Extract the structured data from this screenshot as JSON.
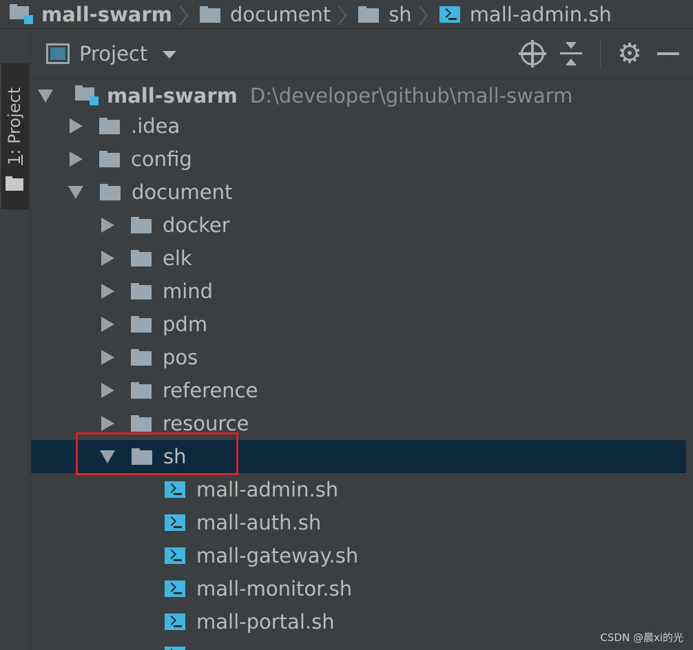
{
  "breadcrumb": {
    "items": [
      {
        "label": "mall-swarm",
        "icon": "module-folder-icon"
      },
      {
        "label": "document",
        "icon": "folder-icon"
      },
      {
        "label": "sh",
        "icon": "folder-icon"
      },
      {
        "label": "mall-admin.sh",
        "icon": "shell-script-icon"
      }
    ]
  },
  "toolwindow_tab": {
    "number": "1",
    "label": ": Project"
  },
  "header": {
    "title": "Project",
    "tools": [
      "locate-icon",
      "collapse-all-icon",
      "gear-icon",
      "hide-icon"
    ],
    "gear_glyph": "⚙"
  },
  "tree": {
    "root": {
      "name": "mall-swarm",
      "path": "D:\\developer\\github\\mall-swarm"
    },
    "items": [
      {
        "name": ".idea"
      },
      {
        "name": "config"
      },
      {
        "name": "document"
      },
      {
        "name": "docker"
      },
      {
        "name": "elk"
      },
      {
        "name": "mind"
      },
      {
        "name": "pdm"
      },
      {
        "name": "pos"
      },
      {
        "name": "reference"
      },
      {
        "name": "resource"
      },
      {
        "name": "sh"
      },
      {
        "name": "mall-admin.sh"
      },
      {
        "name": "mall-auth.sh"
      },
      {
        "name": "mall-gateway.sh"
      },
      {
        "name": "mall-monitor.sh"
      },
      {
        "name": "mall-portal.sh"
      }
    ]
  },
  "watermark": "CSDN @晨xi的光",
  "colors": {
    "background": "#3c3f41",
    "selection": "#0d293e",
    "accent": "#40b6e0",
    "highlight_box": "#e02020",
    "folder": "#9aa7b0"
  }
}
